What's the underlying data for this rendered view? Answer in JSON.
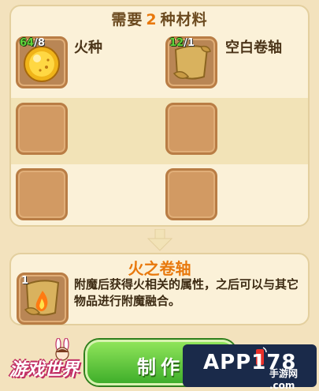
{
  "materials_panel": {
    "header_prefix": "需要",
    "header_count": "2",
    "header_suffix": "种材料",
    "items": [
      {
        "owned": "64",
        "required": "/8",
        "name": "火种",
        "icon": "fire-seed-orb-icon"
      },
      {
        "owned": "12",
        "required": "/1",
        "name": "空白卷轴",
        "icon": "blank-scroll-icon"
      }
    ],
    "empty_slots": 4
  },
  "result": {
    "title": "火之卷轴",
    "quantity": "1",
    "icon": "fire-scroll-icon",
    "description": "附魔后获得火相关的属性，之后可以与其它物品进行附魔融合。"
  },
  "actions": {
    "make_label": "制作"
  },
  "watermarks": {
    "left_logo": "游戏世界",
    "right_logo_main": "APP178",
    "right_logo_sub": "手游网 .com"
  },
  "colors": {
    "accent_orange": "#e8780c",
    "slot_brown": "#d29a63",
    "button_green": "#3fae2a",
    "quantity_green": "#5fd33a"
  }
}
